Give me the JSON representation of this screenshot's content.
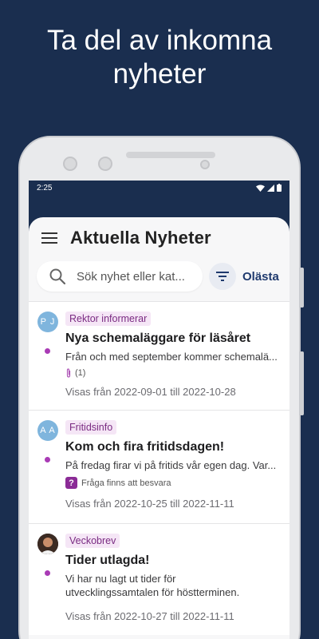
{
  "promo": {
    "title": "Ta del av inkomna nyheter"
  },
  "status": {
    "time": "2:25"
  },
  "app": {
    "title": "Aktuella Nyheter"
  },
  "search": {
    "placeholder": "Sök nyhet eller kat..."
  },
  "filter": {
    "unread_label": "Olästa"
  },
  "colors": {
    "background": "#1a2e4f",
    "accent": "#a93bb5",
    "tag_bg": "#f5e6f6"
  },
  "items": [
    {
      "avatar": "P J",
      "tag": "Rektor informerar",
      "title": "Nya schemaläggare för läsåret",
      "text": "Från och med september kommer schemalä...",
      "attachment_icon": "paperclip-icon",
      "attachment_count": "(1)",
      "dates": "Visas från 2022-09-01 till 2022-10-28"
    },
    {
      "avatar": "A A",
      "tag": "Fritidsinfo",
      "title": "Kom och fira fritidsdagen!",
      "text": "På fredag firar vi på fritids vår egen dag. Var...",
      "question_icon": "question-icon",
      "question_text": "Fråga finns att besvara",
      "dates": "Visas från 2022-10-25 till 2022-11-11"
    },
    {
      "avatar_icon": "photo-avatar",
      "tag": "Veckobrev",
      "title": "Tider utlagda!",
      "text": "Vi har nu lagt ut tider för utvecklingssamtalen för höstterminen.",
      "dates": "Visas från 2022-10-27 till 2022-11-11"
    }
  ]
}
